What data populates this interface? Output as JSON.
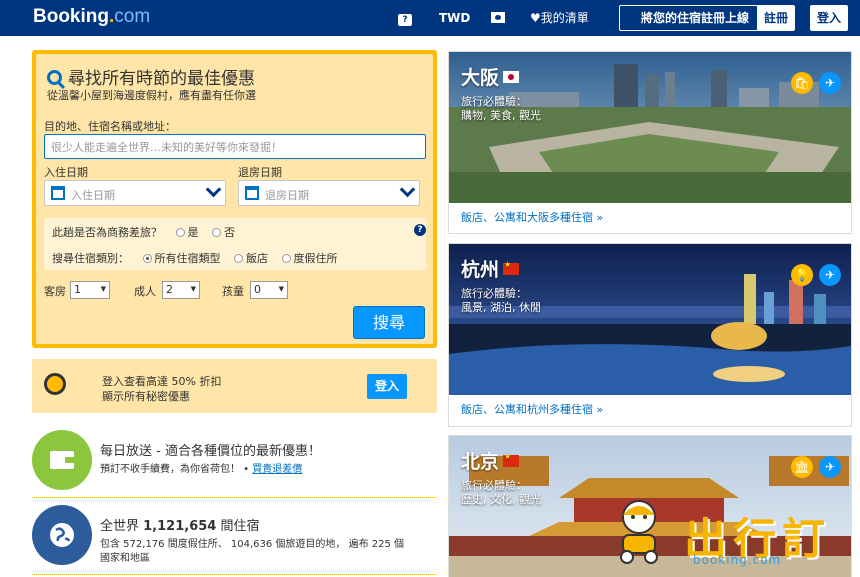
{
  "header": {
    "brand": "Booking",
    "brand_dot": ".",
    "brand_com": "com",
    "help_label": "?",
    "currency": "TWD",
    "wishlist": "我的清單",
    "list_property": "將您的住宿註冊上線",
    "register": "註冊",
    "login": "登入"
  },
  "search": {
    "title": "尋找所有時節的最佳優惠",
    "subtitle": "從溫馨小屋到海邊度假村，應有盡有任你選",
    "dest_label": "目的地、住宿名稱或地址：",
    "dest_placeholder": "很少人能走遍全世界…未知的美好等你來發掘！",
    "checkin_label": "入住日期",
    "checkin_placeholder": "入住日期",
    "checkout_label": "退房日期",
    "checkout_placeholder": "退房日期",
    "business_q": "此趟是否為商務差旅？",
    "yes": "是",
    "no": "否",
    "type_label": "搜尋住宿類別：",
    "type_all": "所有住宿類型",
    "type_hotel": "飯店",
    "type_resort": "度假住所",
    "rooms_label": "客房",
    "rooms_value": "1",
    "adults_label": "成人",
    "adults_value": "2",
    "children_label": "孩童",
    "children_value": "0",
    "button": "搜尋"
  },
  "promo": {
    "line1": "登入查看高達 50% 折扣",
    "line2": "顯示所有秘密優惠",
    "button": "登入"
  },
  "daily": {
    "title": "每日放送 - 適合各種價位的最新優惠！",
    "desc": "預訂不收手續費，為你省荷包！ • ",
    "link": "買貴退差價"
  },
  "world": {
    "title_prefix": "全世界 ",
    "count": "1,121,654",
    "title_suffix": " 間住宿",
    "desc1": "包含 572,176 間度假住所、 104,636 個旅遊目的地， 遍布 225 個",
    "desc2": "國家和地區"
  },
  "cities": [
    {
      "name": "大阪",
      "flag": "jp",
      "exp_label": "旅行必體驗：",
      "exp": "購物, 美食, 觀光",
      "link": "飯店、公寓和大阪多種住宿 »"
    },
    {
      "name": "杭州",
      "flag": "cn",
      "exp_label": "旅行必體驗：",
      "exp": "風景, 湖泊, 休閒",
      "link": "飯店、公寓和杭州多種住宿 »"
    },
    {
      "name": "北京",
      "flag": "cn",
      "exp_label": "旅行必體驗：",
      "exp": "歷史, 文化, 觀光"
    }
  ],
  "watermark": {
    "text": "出行訂",
    "url": "booking.com"
  },
  "colors": {
    "header_bg": "#003580",
    "search_border": "#febb02",
    "search_bg": "#ffe5a7",
    "primary_button": "#0896ff",
    "link": "#0071c2"
  }
}
